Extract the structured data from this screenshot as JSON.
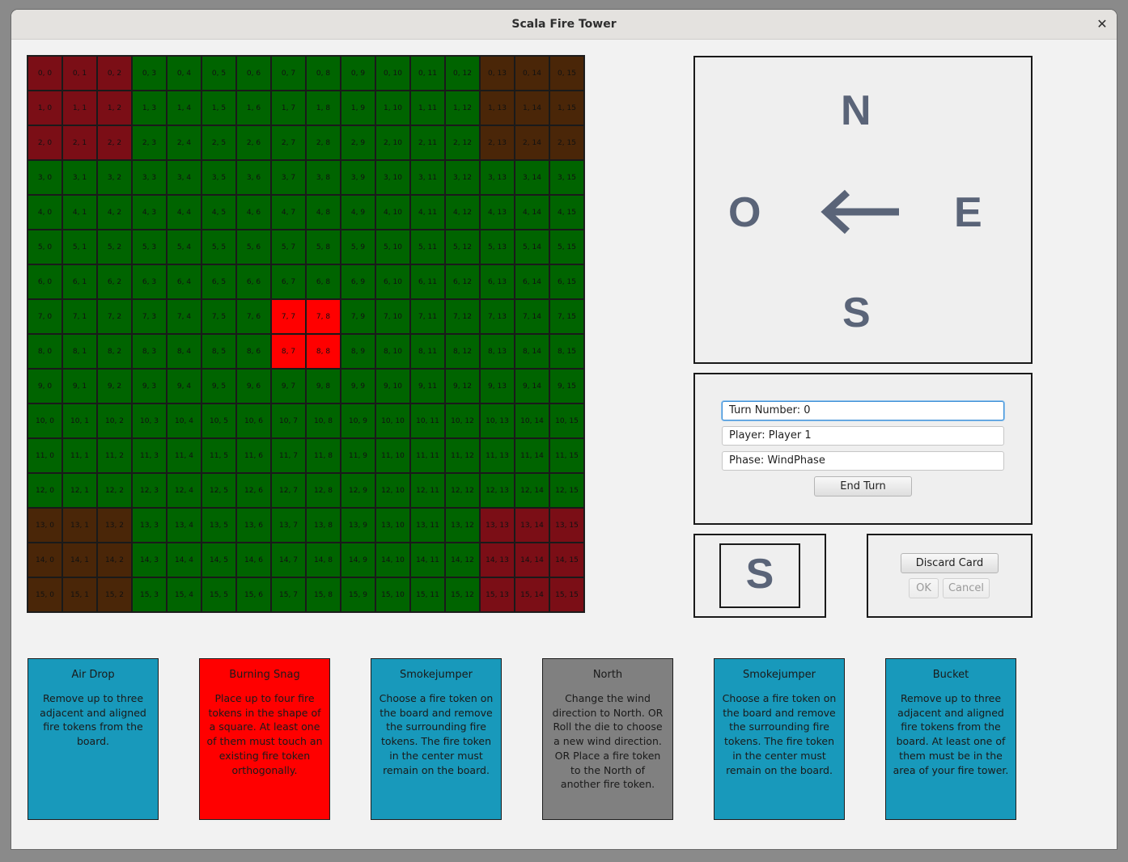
{
  "window": {
    "title": "Scala Fire Tower",
    "close_glyph": "✕"
  },
  "colors": {
    "forest": "#006400",
    "fire": "#ff0000",
    "tower_red": "#7b0e16",
    "tower_brown": "#4a2608"
  },
  "board": {
    "rows": 16,
    "cols": 16,
    "fire_cells": [
      "7, 7",
      "7, 8",
      "8, 7",
      "8, 8"
    ],
    "tower_regions": [
      {
        "color": "tower_red",
        "rows": [
          0,
          1,
          2
        ],
        "cols": [
          0,
          1,
          2
        ]
      },
      {
        "color": "tower_brown",
        "rows": [
          0,
          1,
          2
        ],
        "cols": [
          13,
          14,
          15
        ]
      },
      {
        "color": "tower_brown",
        "rows": [
          13,
          14,
          15
        ],
        "cols": [
          0,
          1,
          2
        ]
      },
      {
        "color": "tower_red",
        "rows": [
          13,
          14,
          15
        ],
        "cols": [
          13,
          14,
          15
        ]
      }
    ]
  },
  "compass": {
    "north": "N",
    "south": "S",
    "east": "E",
    "west": "O",
    "wind_arrow": "arrow-left-icon",
    "wind_direction": "west"
  },
  "status": {
    "turn": "Turn Number: 0",
    "player": "Player: Player 1",
    "phase": "Phase: WindPhase",
    "end_turn": "End Turn"
  },
  "die": {
    "value": "S"
  },
  "discard": {
    "discard_label": "Discard Card",
    "ok_label": "OK",
    "cancel_label": "Cancel"
  },
  "cards": [
    {
      "title": "Air Drop",
      "text": "Remove up to three adjacent and aligned fire tokens from the board.",
      "color": "#1899bb"
    },
    {
      "title": "Burning Snag",
      "text": "Place up to four fire tokens in the shape of a square. At least one of them must touch an existing fire token orthogonally.",
      "color": "#ff0000"
    },
    {
      "title": "Smokejumper",
      "text": "Choose a fire token on the board and remove the surrounding fire tokens. The fire token in the center must remain on the board.",
      "color": "#1899bb"
    },
    {
      "title": "North",
      "text": "Change the wind direction to North. OR Roll the die to choose a new wind direction. OR Place a fire token to the North of another fire token.",
      "color": "#808080"
    },
    {
      "title": "Smokejumper",
      "text": "Choose a fire token on the board and remove the surrounding fire tokens. The fire token in the center must remain on the board.",
      "color": "#1899bb"
    },
    {
      "title": "Bucket",
      "text": "Remove up to three adjacent and aligned fire tokens from the board. At least one of them must be in the area of your fire tower.",
      "color": "#1899bb"
    }
  ]
}
